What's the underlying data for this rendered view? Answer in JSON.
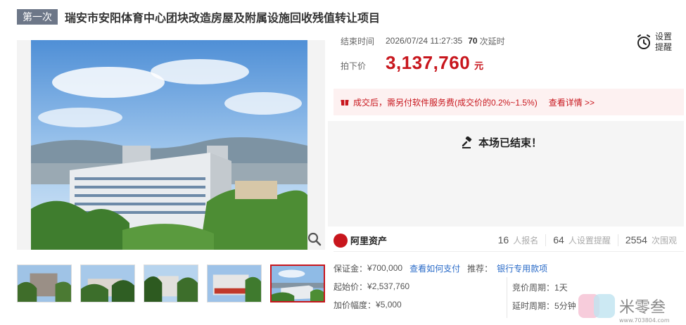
{
  "title": {
    "round_badge": "第一次",
    "text": "瑞安市安阳体育中心团块改造房屋及附属设施回收残值转让项目"
  },
  "auction": {
    "end_label": "结束时间",
    "end_time": "2026/07/24 11:27:35",
    "delay_count": "70",
    "delay_suffix": "次延时",
    "price_label": "拍下价",
    "price": "3,137,760",
    "price_unit": "元"
  },
  "reminder": {
    "line1": "设置",
    "line2": "提醒"
  },
  "notice": {
    "text": "成交后，需另付软件服务费(成交价的0.2%~1.5%)",
    "link": "查看详情 >>"
  },
  "ended": {
    "text": "本场已结束！"
  },
  "platform": {
    "name": "阿里资产",
    "signups": "16",
    "signups_label": "人报名",
    "reminders": "64",
    "reminders_label": "人设置提醒",
    "views": "2554",
    "views_label": "次围观"
  },
  "details": {
    "deposit_label": "保证金：",
    "deposit": "¥700,000",
    "how_to_pay": "查看如何支付",
    "recommend_label": "推荐：",
    "bank_loan": "银行专用款项",
    "start_label": "起始价：",
    "start_price": "¥2,537,760",
    "increment_label": "加价幅度：",
    "increment": "¥5,000",
    "period_label": "竞价周期：",
    "period": "1天",
    "delay_label": "延时周期：",
    "delay": "5分钟"
  },
  "watermark": {
    "text": "米零叁",
    "url": "www.703804.com"
  },
  "colors": {
    "accent": "#c8161d",
    "link": "#2a6bc8",
    "badge": "#6d7788"
  }
}
